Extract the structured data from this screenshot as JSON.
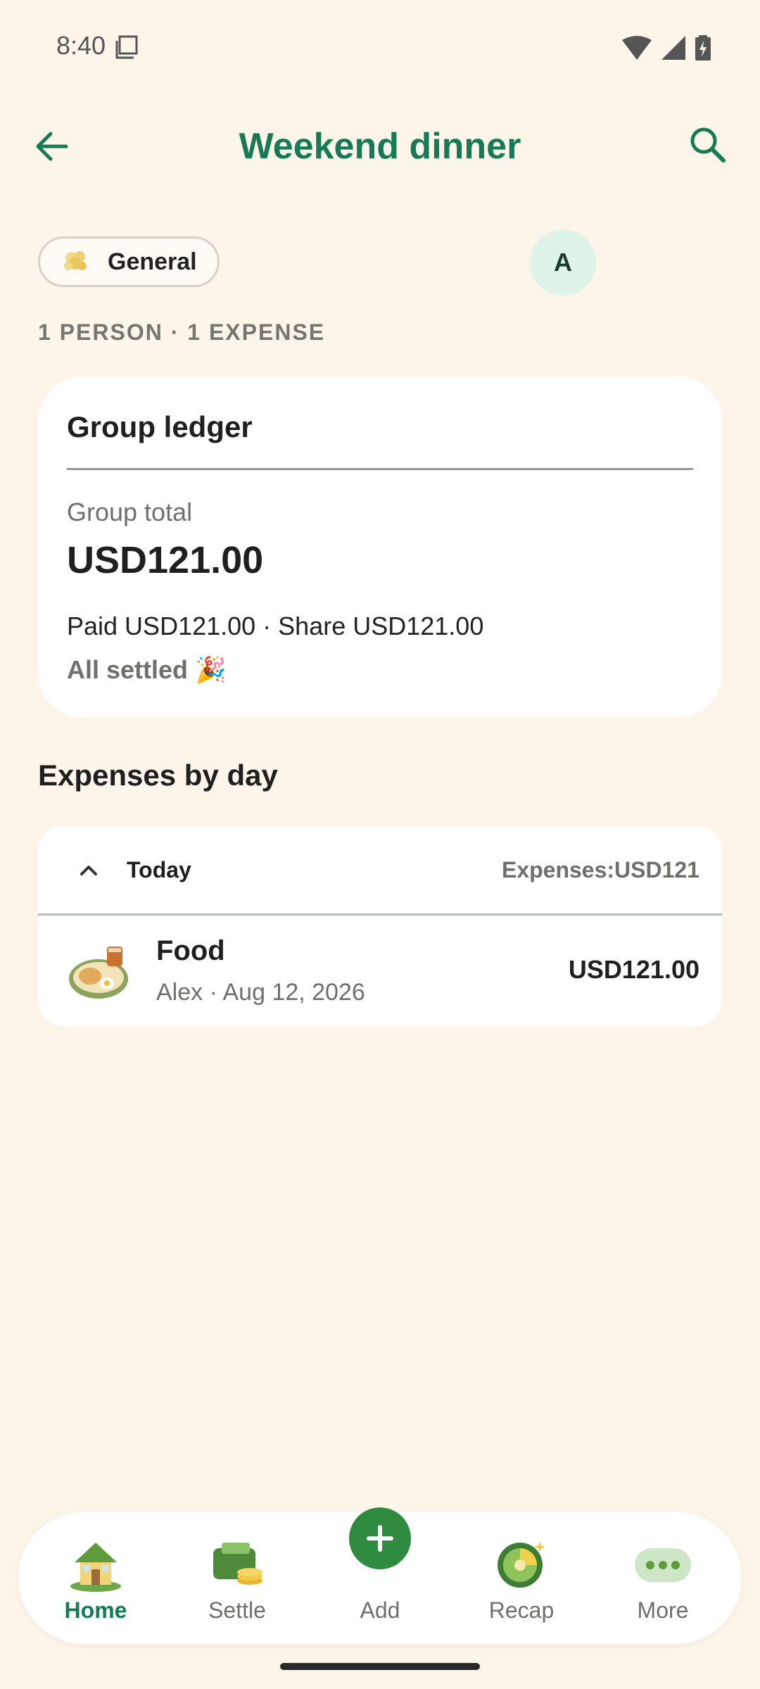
{
  "status": {
    "time": "8:40"
  },
  "header": {
    "title": "Weekend dinner"
  },
  "category_chip": {
    "label": "General"
  },
  "avatar": {
    "initial": "A"
  },
  "meta": {
    "summary": "1 PERSON · 1 EXPENSE"
  },
  "ledger": {
    "title": "Group ledger",
    "total_label": "Group total",
    "total_value": "USD121.00",
    "paid_share": "Paid USD121.00 · Share USD121.00",
    "settled": "All settled 🎉"
  },
  "expenses_section": {
    "title": "Expenses by day"
  },
  "day_group": {
    "label": "Today",
    "total": "Expenses:USD121",
    "items": [
      {
        "name": "Food",
        "sub": "Alex · Aug 12, 2026",
        "amount": "USD121.00"
      }
    ]
  },
  "nav": {
    "items": [
      {
        "label": "Home"
      },
      {
        "label": "Settle"
      },
      {
        "label": "Add"
      },
      {
        "label": "Recap"
      },
      {
        "label": "More"
      }
    ]
  },
  "colors": {
    "accent": "#167a55",
    "background": "#fdf5ea",
    "card": "#ffffff"
  }
}
